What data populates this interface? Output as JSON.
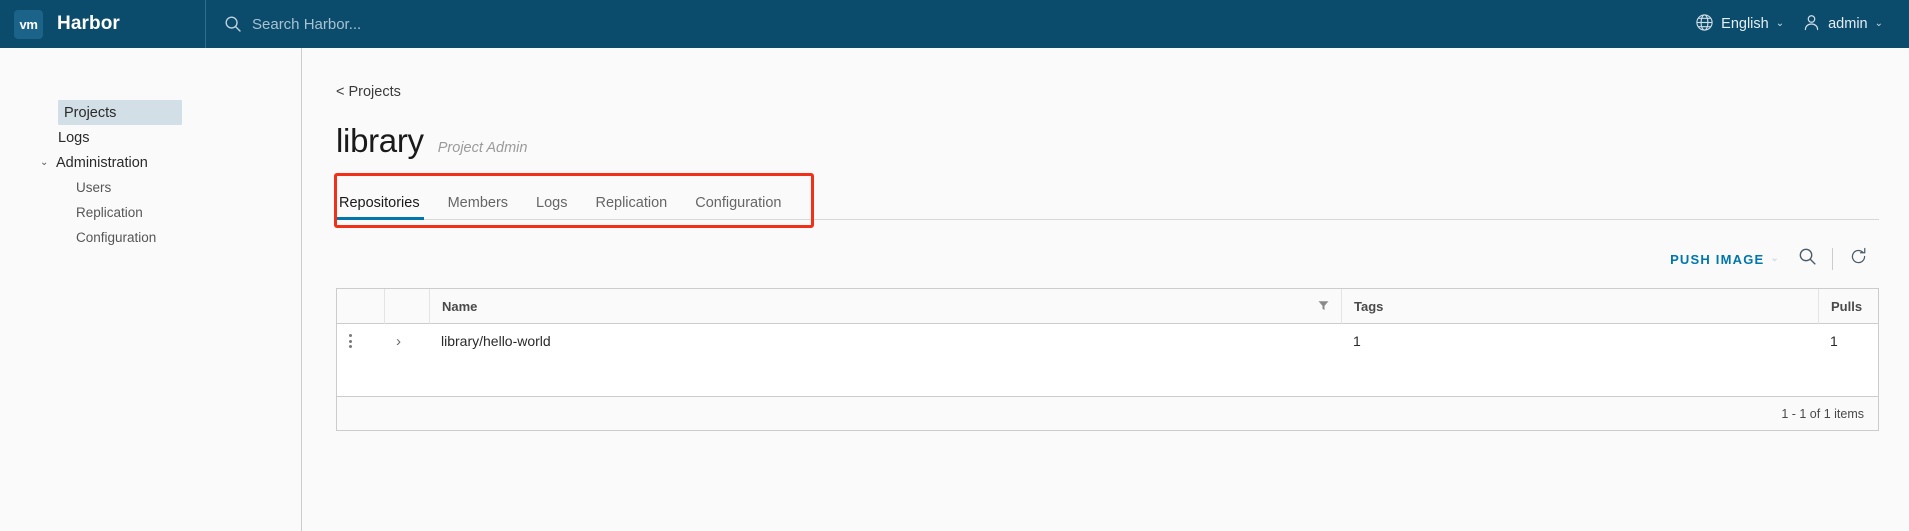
{
  "header": {
    "logo_text": "vm",
    "logo_icon": "vmware-logo-icon",
    "brand": "Harbor",
    "search": {
      "icon": "search-icon",
      "placeholder": "Search Harbor...",
      "value": ""
    },
    "language": {
      "icon": "globe-icon",
      "label": "English",
      "caret": "⌄"
    },
    "user": {
      "icon": "user-icon",
      "label": "admin",
      "caret": "⌄"
    },
    "bg_color": "#0b4b6b"
  },
  "sidebar": {
    "items": [
      {
        "label": "Projects",
        "name": "sidebar-item-projects",
        "type": "item",
        "active": true
      },
      {
        "label": "Logs",
        "name": "sidebar-item-logs",
        "type": "item",
        "active": false
      },
      {
        "label": "Administration",
        "name": "sidebar-group-administration",
        "type": "group",
        "caret": "⌄"
      },
      {
        "label": "Users",
        "name": "sidebar-item-users",
        "type": "sub"
      },
      {
        "label": "Replication",
        "name": "sidebar-item-replication",
        "type": "sub"
      },
      {
        "label": "Configuration",
        "name": "sidebar-item-configuration",
        "type": "sub"
      }
    ]
  },
  "main": {
    "breadcrumb": "< Projects",
    "title": "library",
    "role": "Project Admin",
    "tabs": [
      {
        "label": "Repositories",
        "active": true
      },
      {
        "label": "Members",
        "active": false
      },
      {
        "label": "Logs",
        "active": false
      },
      {
        "label": "Replication",
        "active": false
      },
      {
        "label": "Configuration",
        "active": false
      }
    ],
    "highlight_color": "#f23018",
    "accent_color": "#0076ad",
    "actions": {
      "push_image_label": "PUSH IMAGE",
      "push_image_caret": "⌄",
      "search_icon": "search-icon",
      "refresh_icon": "refresh-icon"
    },
    "table": {
      "columns": [
        {
          "label": "",
          "name": "column-kebab"
        },
        {
          "label": "",
          "name": "column-expand"
        },
        {
          "label": "Name",
          "name": "column-name",
          "filter_icon": "filter-icon"
        },
        {
          "label": "Tags",
          "name": "column-tags"
        },
        {
          "label": "Pulls",
          "name": "column-pulls"
        }
      ],
      "rows": [
        {
          "kebab_icon": "kebab-menu-icon",
          "expand_icon": "chevron-right-icon",
          "name": "library/hello-world",
          "tags": "1",
          "pulls": "1"
        }
      ],
      "footer": "1 - 1 of 1 items"
    }
  }
}
